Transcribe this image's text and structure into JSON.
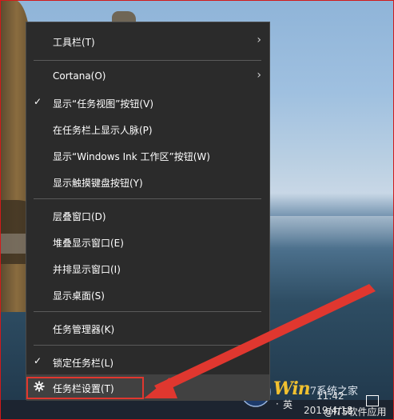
{
  "menu": {
    "items": [
      {
        "label": "工具栏(T)",
        "submenu": true,
        "checked": false
      },
      {
        "label": "Cortana(O)",
        "submenu": true,
        "checked": false
      },
      {
        "label": "显示“任务视图”按钮(V)",
        "submenu": false,
        "checked": true
      },
      {
        "label": "在任务栏上显示人脉(P)",
        "submenu": false,
        "checked": false
      },
      {
        "label": "显示“Windows Ink 工作区”按钮(W)",
        "submenu": false,
        "checked": false
      },
      {
        "label": "显示触摸键盘按钮(Y)",
        "submenu": false,
        "checked": false
      },
      {
        "label": "层叠窗口(D)",
        "submenu": false,
        "checked": false
      },
      {
        "label": "堆叠显示窗口(E)",
        "submenu": false,
        "checked": false
      },
      {
        "label": "并排显示窗口(I)",
        "submenu": false,
        "checked": false
      },
      {
        "label": "显示桌面(S)",
        "submenu": false,
        "checked": false
      },
      {
        "label": "任务管理器(K)",
        "submenu": false,
        "checked": false
      },
      {
        "label": "锁定任务栏(L)",
        "submenu": false,
        "checked": true
      },
      {
        "label": "任务栏设置(T)",
        "submenu": false,
        "checked": false,
        "icon": "gear-icon"
      }
    ],
    "check_glyph": "✓",
    "arrow_glyph": "›"
  },
  "taskbar": {
    "time": "11:42",
    "date": "2019/4/18",
    "ime": "英",
    "ime_prefix": "·",
    "tray_icons": [
      "network-icon",
      "notification-icon"
    ]
  },
  "watermark": {
    "brand": "Win",
    "brand_suffix": "7系统之家",
    "weibo_text": "@IT5软件应用"
  },
  "colors": {
    "menu_bg": "#2b2b2b",
    "menu_text": "#ffffff",
    "highlight_border": "#e0372f",
    "arrow_red": "#e0372f"
  }
}
